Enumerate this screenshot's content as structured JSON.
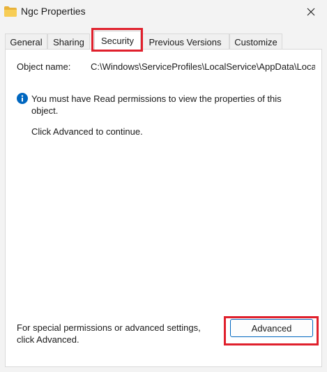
{
  "window": {
    "title": "Ngc Properties"
  },
  "tabs": [
    {
      "label": "General"
    },
    {
      "label": "Sharing"
    },
    {
      "label": "Security",
      "selected": true
    },
    {
      "label": "Previous Versions"
    },
    {
      "label": "Customize"
    }
  ],
  "security": {
    "object_name_label": "Object name:",
    "object_name_value": "C:\\Windows\\ServiceProfiles\\LocalService\\AppData\\Local\\Microsoft\\Ngc",
    "info_message": "You must have Read permissions to view the properties of this object.",
    "continue_message": "Click Advanced to continue.",
    "special_permissions_text": "For special permissions or advanced settings, click Advanced.",
    "advanced_button_label": "Advanced"
  },
  "colors": {
    "highlight": "#e0202c",
    "accent": "#0067c0",
    "folder": "#f4c542"
  },
  "icons": [
    "folder-icon",
    "close-icon",
    "info-icon"
  ]
}
